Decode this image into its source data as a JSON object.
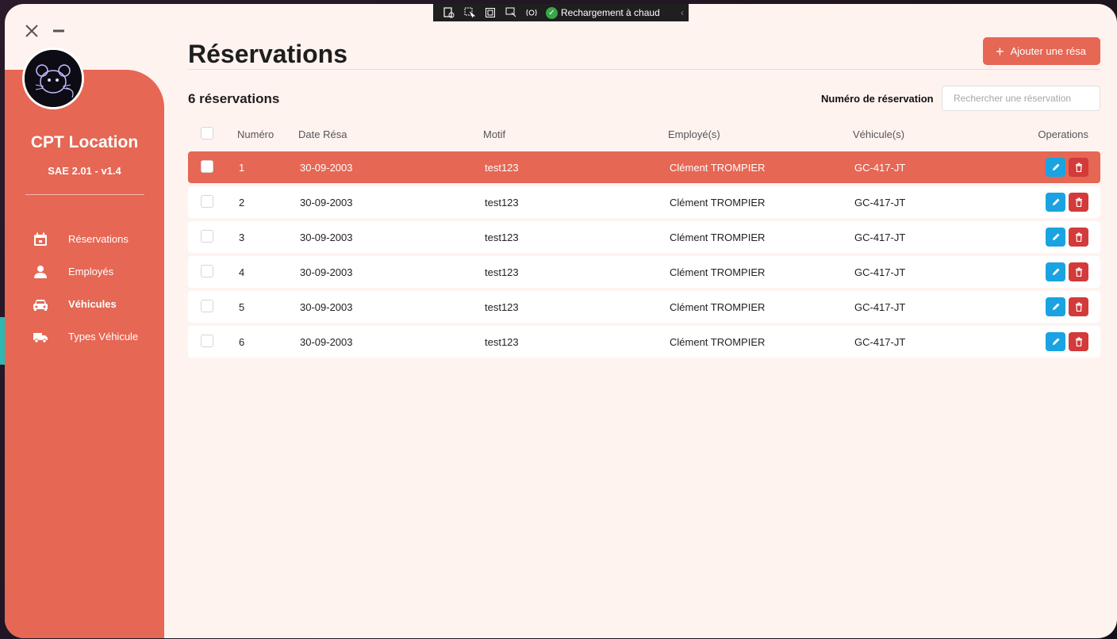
{
  "toolbar": {
    "hot_reload_label": "Rechargement à chaud"
  },
  "sidebar": {
    "title": "CPT Location",
    "subtitle": "SAE 2.01 - v1.4",
    "items": [
      {
        "label": "Réservations",
        "icon": "calendar-icon"
      },
      {
        "label": "Employés",
        "icon": "person-icon"
      },
      {
        "label": "Véhicules",
        "icon": "car-icon"
      },
      {
        "label": "Types Véhicule",
        "icon": "truck-icon"
      }
    ]
  },
  "main": {
    "title": "Réservations",
    "add_button_label": "Ajouter une résa",
    "count_label": "6 réservations",
    "search_label": "Numéro de réservation",
    "search_placeholder": "Rechercher une réservation",
    "columns": [
      "Numéro",
      "Date Résa",
      "Motif",
      "Employé(s)",
      "Véhicule(s)",
      "Operations"
    ],
    "rows": [
      {
        "num": "1",
        "date": "30-09-2003",
        "motif": "test123",
        "employe": "Clément TROMPIER",
        "vehicule": "GC-417-JT"
      },
      {
        "num": "2",
        "date": "30-09-2003",
        "motif": "test123",
        "employe": "Clément TROMPIER",
        "vehicule": "GC-417-JT"
      },
      {
        "num": "3",
        "date": "30-09-2003",
        "motif": "test123",
        "employe": "Clément TROMPIER",
        "vehicule": "GC-417-JT"
      },
      {
        "num": "4",
        "date": "30-09-2003",
        "motif": "test123",
        "employe": "Clément TROMPIER",
        "vehicule": "GC-417-JT"
      },
      {
        "num": "5",
        "date": "30-09-2003",
        "motif": "test123",
        "employe": "Clément TROMPIER",
        "vehicule": "GC-417-JT"
      },
      {
        "num": "6",
        "date": "30-09-2003",
        "motif": "test123",
        "employe": "Clément TROMPIER",
        "vehicule": "GC-417-JT"
      }
    ]
  },
  "colors": {
    "accent": "#e56754",
    "background": "#fff3f0",
    "edit": "#1aa3e0",
    "delete": "#d33a3a"
  }
}
